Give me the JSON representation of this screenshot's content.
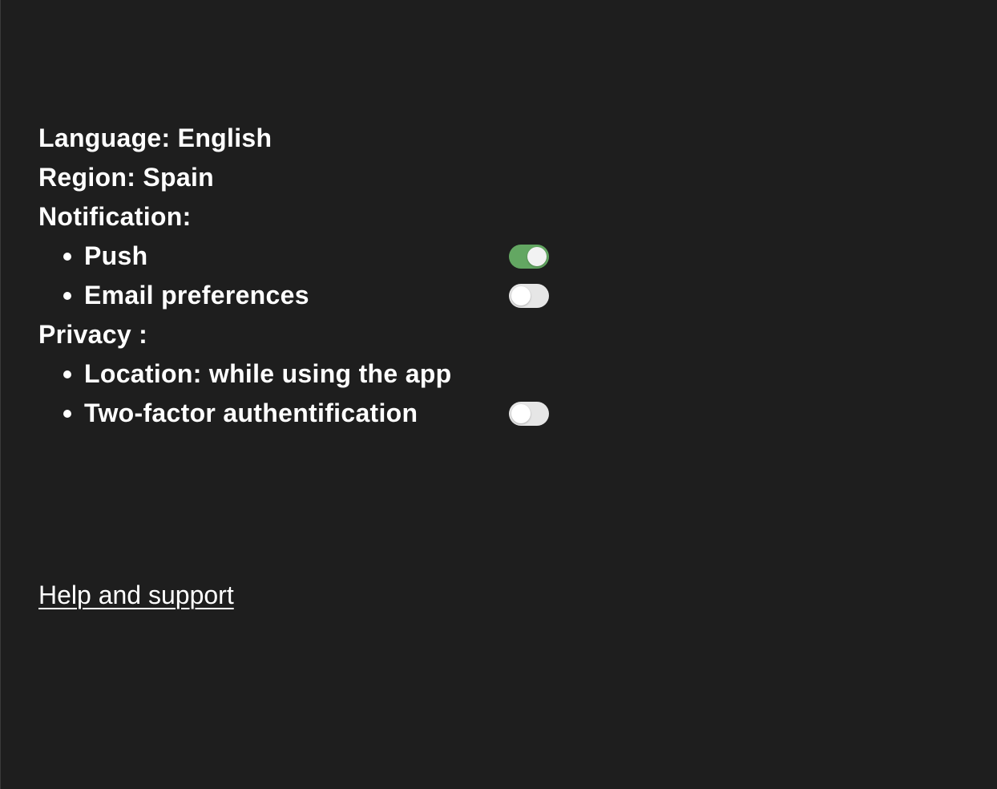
{
  "settings": {
    "language": "Language: English",
    "region": "Region: Spain",
    "notification": {
      "heading": "Notification:",
      "items": [
        {
          "label": "Push",
          "toggle_on": true
        },
        {
          "label": "Email preferences",
          "toggle_on": false
        }
      ]
    },
    "privacy": {
      "heading": "Privacy :",
      "items": [
        {
          "label": "Location: while using the app"
        },
        {
          "label": "Two-factor authentification",
          "toggle_on": false
        }
      ]
    }
  },
  "footer": {
    "help_link": "Help and support"
  },
  "colors": {
    "background": "#1e1e1e",
    "toggle_on": "#63a762",
    "toggle_off": "#e6e6e6",
    "text": "#ffffff"
  }
}
